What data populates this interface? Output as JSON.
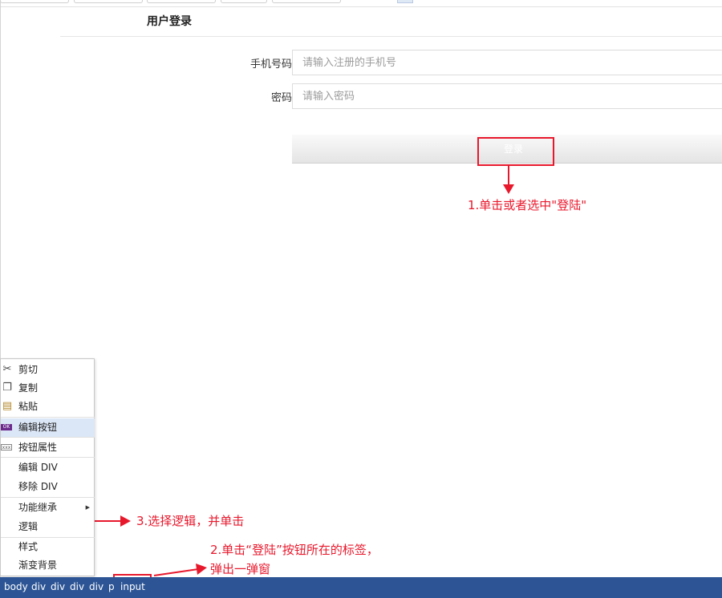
{
  "form": {
    "title": "用户登录",
    "phone_label": "手机号码",
    "phone_placeholder": "请输入注册的手机号",
    "password_label": "密码",
    "password_placeholder": "请输入密码",
    "login_label": "登录"
  },
  "annotations": {
    "step1": "1.单击或者选中\"登陆\"",
    "step2_line1": "2.单击“登陆”按钮所在的标签，",
    "step2_line2": "弹出一弹窗",
    "step3": "3.选择逻辑，并单击",
    "color": "#e8182c"
  },
  "context_menu": {
    "items": [
      {
        "label": "剪切",
        "icon": "scissors-icon"
      },
      {
        "label": "复制",
        "icon": "copy-icon"
      },
      {
        "label": "粘贴",
        "icon": "paste-icon"
      },
      {
        "label": "编辑按钮",
        "icon": "edit-button-icon"
      },
      {
        "label": "按钮属性",
        "icon": "button-properties-icon"
      },
      {
        "label": "编辑 DIV",
        "icon": ""
      },
      {
        "label": "移除 DIV",
        "icon": ""
      },
      {
        "label": "功能继承",
        "icon": "submenu-arrow-icon"
      },
      {
        "label": "逻辑",
        "icon": ""
      },
      {
        "label": "样式",
        "icon": ""
      },
      {
        "label": "渐变背景",
        "icon": ""
      }
    ],
    "highlight_color": "#dbe6f6"
  },
  "statusbar": {
    "background": "#2d5595",
    "crumbs": [
      "body",
      "div",
      "div",
      "div",
      "div",
      "p",
      "input"
    ]
  }
}
